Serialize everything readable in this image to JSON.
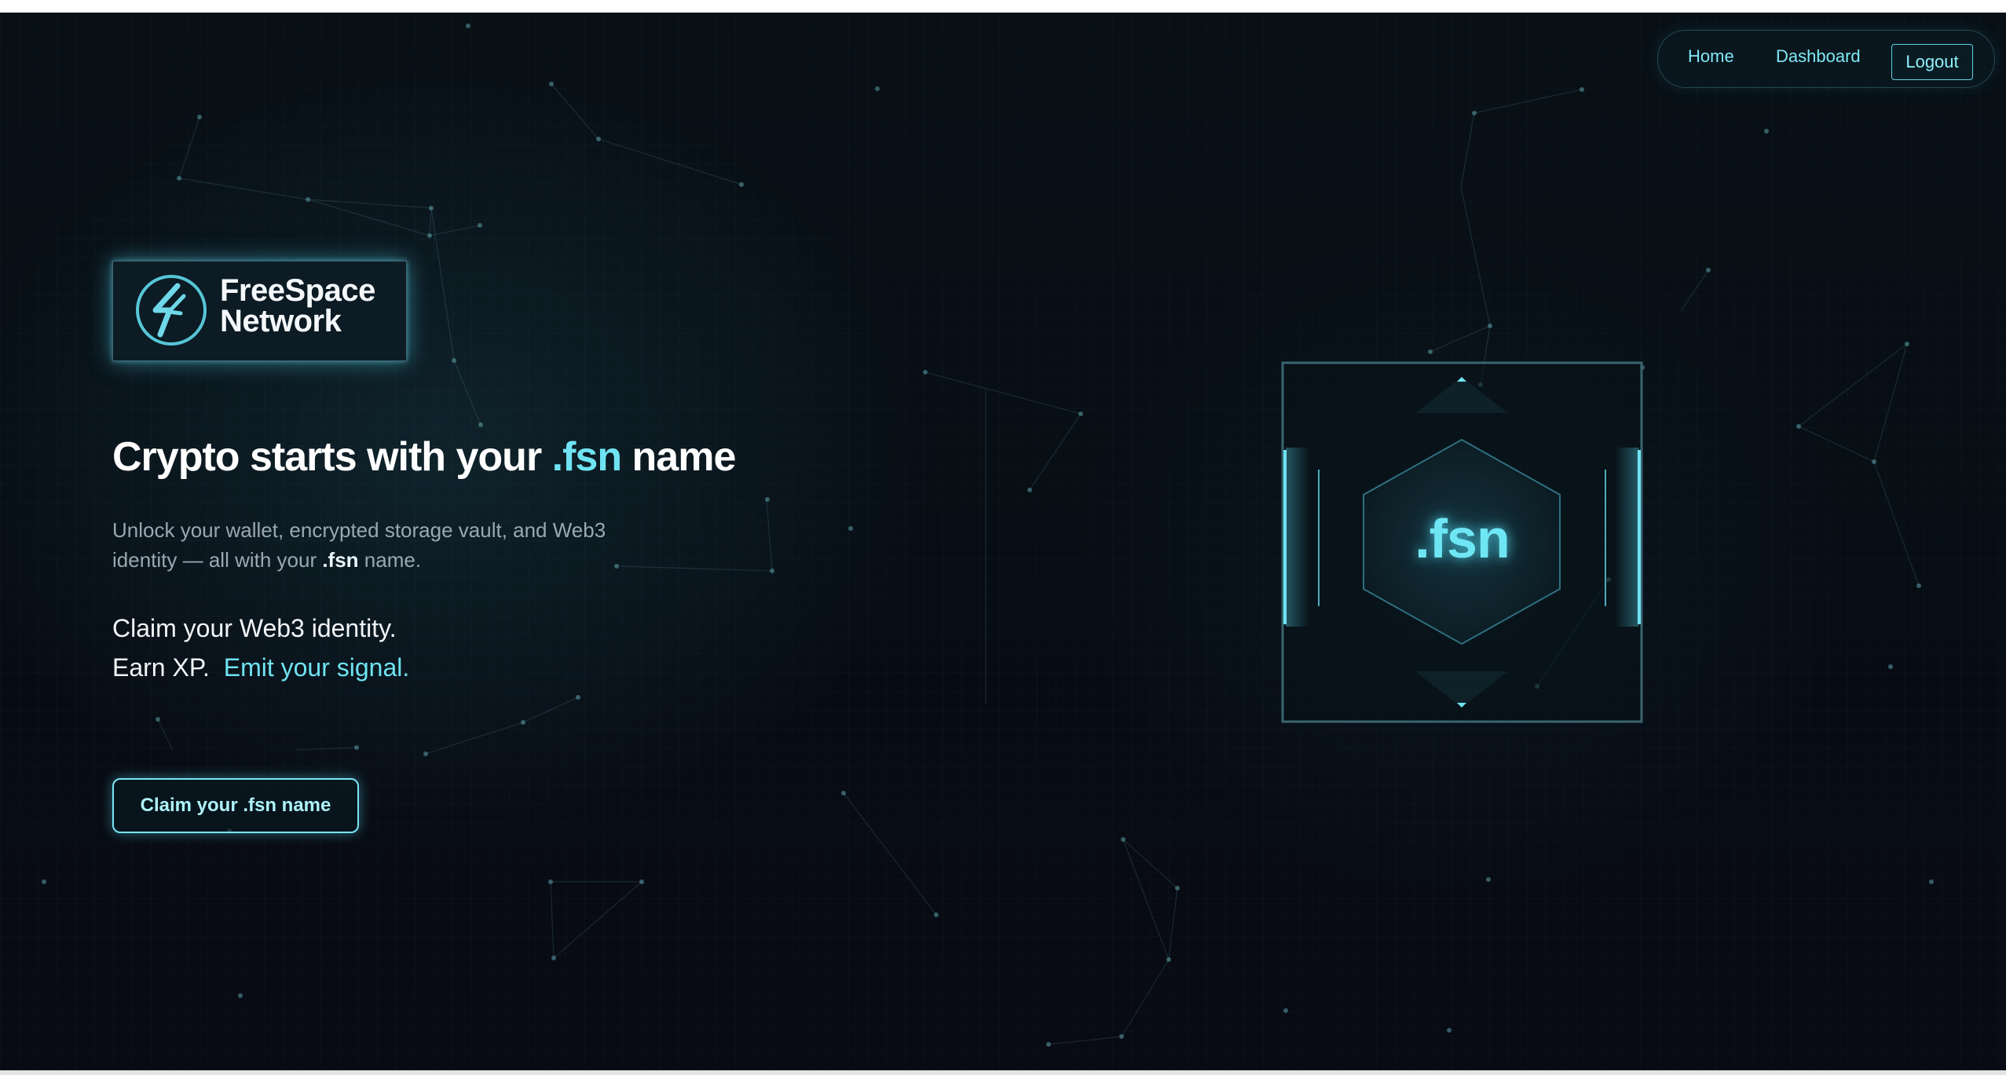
{
  "nav": {
    "home": "Home",
    "dashboard": "Dashboard",
    "logout": "Logout"
  },
  "brand": {
    "line1": "FreeSpace",
    "line2": "Network",
    "icon": "lightning-circle-logo"
  },
  "hero": {
    "headline_before": "Crypto starts with your ",
    "headline_accent": ".fsn",
    "headline_after": " name",
    "sub_before": "Unlock your wallet, encrypted storage vault, and Web3 identity — all with your ",
    "sub_bold": ".fsn",
    "sub_after": " name.",
    "claim_line1": "Claim your Web3 identity.",
    "claim_line2_plain": "Earn XP.",
    "claim_line2_accent": "Emit your signal.",
    "cta": "Claim your .fsn name"
  },
  "emblem": {
    "label": ".fsn"
  },
  "colors": {
    "accent": "#6fe3f2",
    "background": "#070d14",
    "border": "#3a6470"
  }
}
